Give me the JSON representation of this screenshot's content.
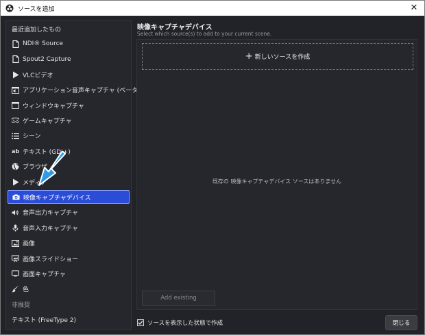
{
  "window": {
    "title": "ソースを追加",
    "close_symbol": "✕"
  },
  "source_list": {
    "header": "最近追加したもの",
    "items": [
      {
        "label": "NDI® Source",
        "icon": "file-icon"
      },
      {
        "label": "Spout2 Capture",
        "icon": "file-icon"
      },
      {
        "label": "VLCビデオ",
        "icon": "play-icon"
      },
      {
        "label": "アプリケーション音声キャプチャ (ベータ版)",
        "icon": "app-audio-icon"
      },
      {
        "label": "ウィンドウキャプチャ",
        "icon": "window-icon"
      },
      {
        "label": "ゲームキャプチャ",
        "icon": "gamepad-icon"
      },
      {
        "label": "シーン",
        "icon": "list-icon"
      },
      {
        "label": "テキスト (GDI+)",
        "icon": "text-icon"
      },
      {
        "label": "ブラウザ",
        "icon": "globe-icon"
      },
      {
        "label": "メディア",
        "icon": "play-icon"
      },
      {
        "label": "映像キャプチャデバイス",
        "icon": "camera-icon",
        "selected": true
      },
      {
        "label": "音声出力キャプチャ",
        "icon": "speaker-icon"
      },
      {
        "label": "音声入力キャプチャ",
        "icon": "microphone-icon"
      },
      {
        "label": "画像",
        "icon": "image-icon"
      },
      {
        "label": "画像スライドショー",
        "icon": "slideshow-icon"
      },
      {
        "label": "画面キャプチャ",
        "icon": "monitor-icon"
      },
      {
        "label": "色",
        "icon": "brush-icon"
      }
    ],
    "deprecated_header": "非推奨",
    "deprecated_items": [
      {
        "label": "テキスト (FreeType 2)"
      }
    ]
  },
  "right": {
    "title": "映像キャプチャデバイス",
    "subtitle": "Select which source(s) to add to your current scene.",
    "new_source_plus": "+",
    "new_source_label": "新しいソースを作成",
    "empty_message": "既存の 映像キャプチャデバイス ソースはありません",
    "add_existing_label": "Add existing"
  },
  "footer": {
    "visible_checkbox_label": "ソースを表示した状態で作成",
    "visible_checked": true,
    "close_label": "閉じる"
  },
  "colors": {
    "selected": "#2a4cd7",
    "arrow": "#2f9be8",
    "background": "#222328"
  }
}
